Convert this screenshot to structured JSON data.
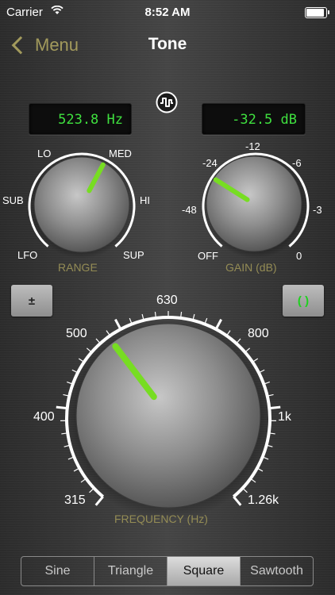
{
  "status_bar": {
    "carrier": "Carrier",
    "time": "8:52 AM",
    "battery_level": 1.0
  },
  "nav": {
    "back_label": "Menu",
    "title": "Tone"
  },
  "frequency_display": "523.8 Hz",
  "gain_display": "-32.5 dB",
  "range_knob": {
    "caption": "RANGE",
    "labels": {
      "lfo": "LFO",
      "sub": "SUB",
      "lo": "LO",
      "med": "MED",
      "hi": "HI",
      "sup": "SUP"
    },
    "selected": "MED"
  },
  "gain_knob": {
    "caption": "GAIN (dB)",
    "labels": {
      "off": "OFF",
      "m48": "-48",
      "m24": "-24",
      "m12": "-12",
      "m6": "-6",
      "m3": "-3",
      "zero": "0"
    },
    "value_db": -32.5
  },
  "frequency_knob": {
    "caption": "FREQUENCY (Hz)",
    "labels": {
      "f315": "315",
      "f400": "400",
      "f500": "500",
      "f630": "630",
      "f800": "800",
      "f1k": "1k",
      "f126k": "1.26k"
    },
    "value_hz": 523.8
  },
  "buttons": {
    "polarity": "±",
    "stereo": "( )"
  },
  "waveforms": {
    "items": [
      "Sine",
      "Triangle",
      "Square",
      "Sawtooth"
    ],
    "selected": "Square"
  },
  "colors": {
    "accent_gold": "#a29a5c",
    "display_green": "#3fe03f",
    "indicator_green": "#77dd22"
  }
}
